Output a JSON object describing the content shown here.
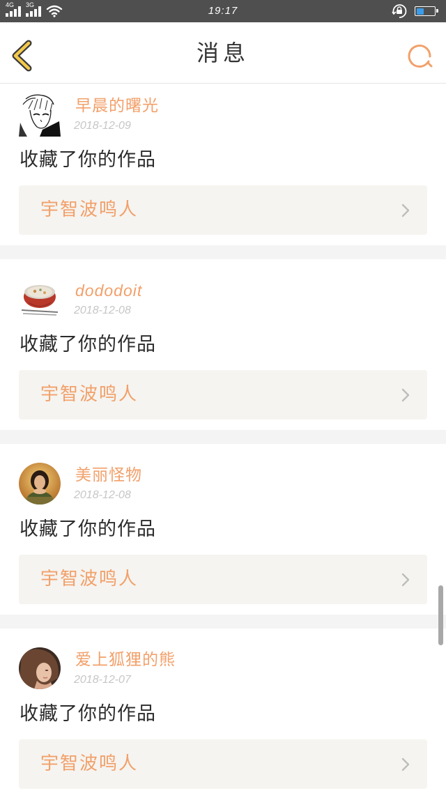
{
  "status_bar": {
    "network_1": "4G",
    "network_2": "3G",
    "time": "19:17",
    "battery_level": 0.4
  },
  "header": {
    "title": "消息",
    "back_icon": "chevron-left-icon",
    "search_icon": "search-icon"
  },
  "messages": [
    {
      "user_name": "早晨的曙光",
      "date": "2018-12-09",
      "action": "收藏了你的作品",
      "work_title": "宇智波鸣人"
    },
    {
      "user_name": "dododoit",
      "date": "2018-12-08",
      "action": "收藏了你的作品",
      "work_title": "宇智波鸣人"
    },
    {
      "user_name": "美丽怪物",
      "date": "2018-12-08",
      "action": "收藏了你的作品",
      "work_title": "宇智波鸣人"
    },
    {
      "user_name": "爱上狐狸的熊",
      "date": "2018-12-07",
      "action": "收藏了你的作品",
      "work_title": "宇智波鸣人"
    }
  ],
  "colors": {
    "status_bar_bg": "#4f4f4f",
    "accent": "#f2a06a",
    "back_icon": "#f3c94b",
    "text": "#2b2b2b",
    "date": "#c6c6c6",
    "work_box_bg": "#f5f4f0",
    "separator": "#f4f4f4",
    "battery": "#3b9cea"
  }
}
